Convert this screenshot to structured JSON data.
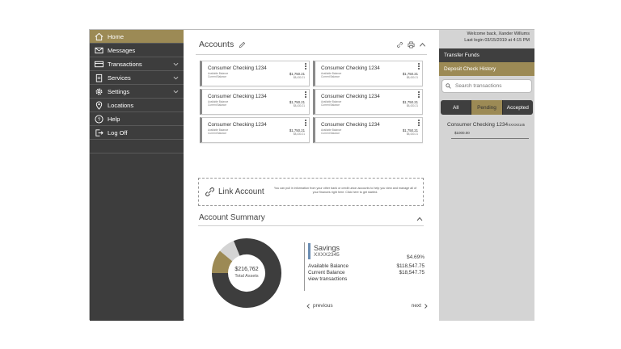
{
  "user": {
    "welcome": "Welcome back, Xander Willums",
    "last_login": "Last login 03/15/2019 at 4:15 PM"
  },
  "sidebar": {
    "items": [
      {
        "label": "Home",
        "icon": "home-icon",
        "active": true
      },
      {
        "label": "Messages",
        "icon": "envelope-icon"
      },
      {
        "label": "Transactions",
        "icon": "card-icon",
        "expandable": true
      },
      {
        "label": "Services",
        "icon": "clipboard-icon",
        "expandable": true
      },
      {
        "label": "Settings",
        "icon": "gear-icon",
        "expandable": true
      },
      {
        "label": "Locations",
        "icon": "location-pin-icon"
      },
      {
        "label": "Help",
        "icon": "question-icon"
      },
      {
        "label": "Log Off",
        "icon": "logout-icon"
      }
    ]
  },
  "accounts": {
    "title": "Accounts",
    "cards": [
      {
        "name": "Consumer Checking 1234",
        "available_label": "Available Balance",
        "current_label": "Current Balance",
        "available": "$1,750.21",
        "current": "$8,430.21"
      },
      {
        "name": "Consumer Checking 1234",
        "available_label": "Available Balance",
        "current_label": "Current Balance",
        "available": "$1,750.21",
        "current": "$8,430.21"
      },
      {
        "name": "Consumer Checking 1234",
        "available_label": "Available Balance",
        "current_label": "Current Balance",
        "available": "$1,750.21",
        "current": "$8,430.21"
      },
      {
        "name": "Consumer Checking 1234",
        "available_label": "Available Balance",
        "current_label": "Current Balance",
        "available": "$1,750.21",
        "current": "$8,430.21"
      },
      {
        "name": "Consumer Checking 1234",
        "available_label": "Available Balance",
        "current_label": "Current Balance",
        "available": "$1,750.21",
        "current": "$8,430.21"
      },
      {
        "name": "Consumer Checking 1234",
        "available_label": "Available Balance",
        "current_label": "Current Balance",
        "available": "$1,750.21",
        "current": "$8,430.21"
      }
    ]
  },
  "link_account": {
    "title": "Link Account",
    "text": "You can pull in information from your other bank or credit union accounts to help you view and manage all of your finances right here. Click here to get started."
  },
  "summary": {
    "title": "Account Summary",
    "total_value": "$216,762",
    "total_label": "Total Assets",
    "donut_colors": [
      "#3d3d3d",
      "#9c8a55",
      "#d4d4d4"
    ],
    "donut_shares": [
      0.81,
      0.11,
      0.08
    ],
    "account_name": "Savings",
    "account_number": "XXXX2345",
    "rate": "$4.69%",
    "available_label": "Available Balance",
    "available": "$118,547.75",
    "current_label": "Current Balance",
    "current": "$18,547.75",
    "view_label": "view transactions",
    "prev_label": "previous",
    "next_label": "next"
  },
  "right_panel": {
    "transfer_label": "Transfer Funds",
    "deposit_label": "Deposit Check History",
    "search_placeholder": "Search transactions",
    "tabs": [
      "All",
      "Pending",
      "Accepted"
    ],
    "active_tab": "Pending",
    "transaction": {
      "name": "Consumer Checking 1234",
      "number": "XXXX0145",
      "amount": "$1000.00"
    }
  }
}
